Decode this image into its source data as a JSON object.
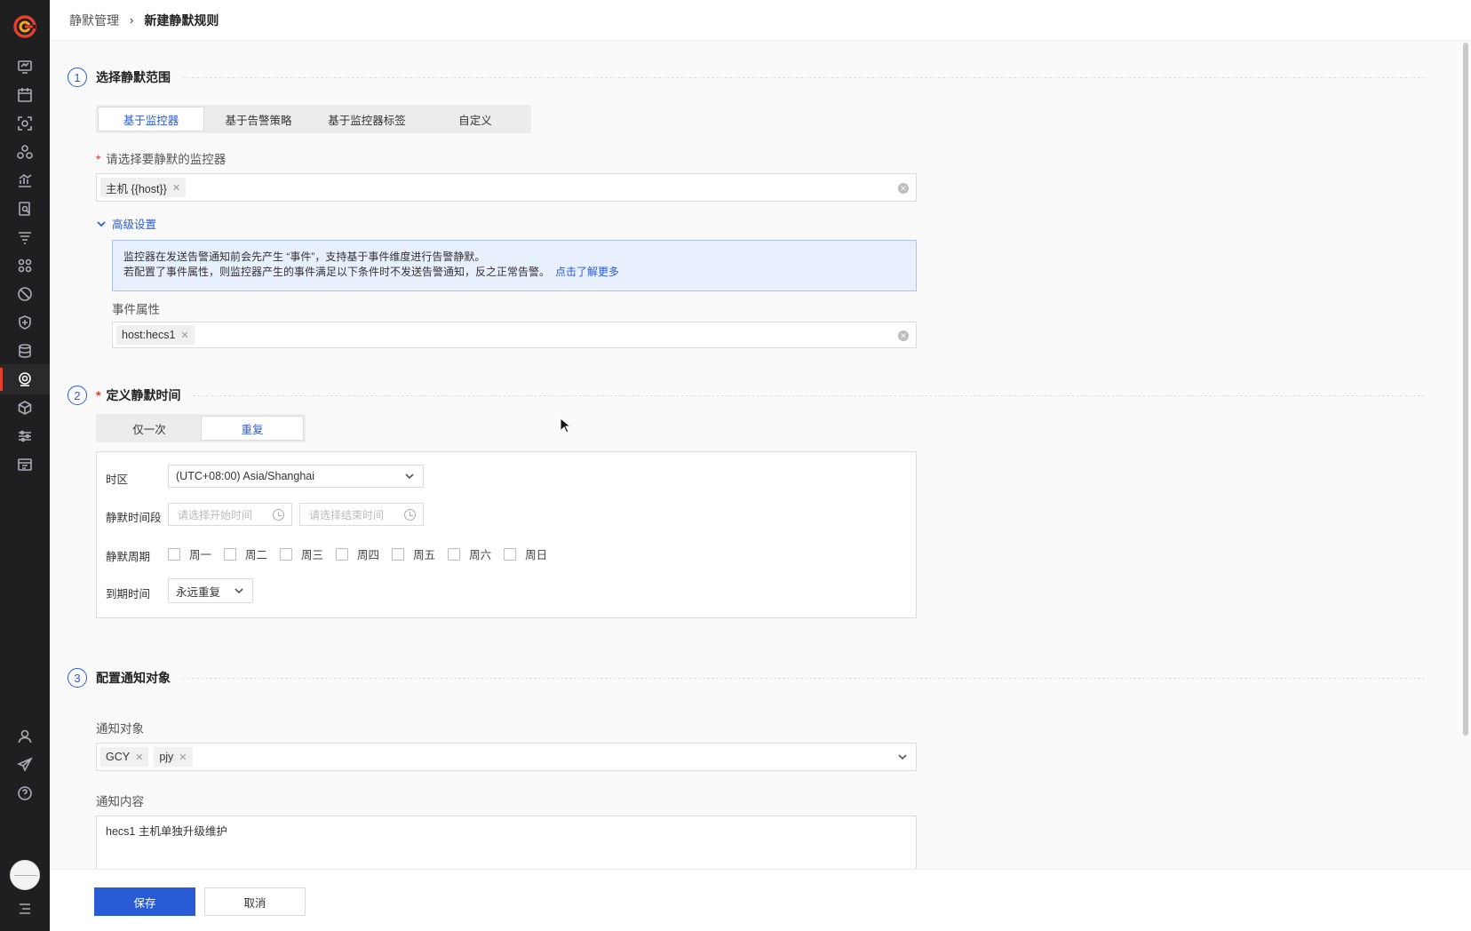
{
  "breadcrumb": {
    "parent": "静默管理",
    "separator": "›",
    "current": "新建静默规则"
  },
  "step1": {
    "number": "1",
    "title": "选择静默范围",
    "tabs": [
      "基于监控器",
      "基于告警策略",
      "基于监控器标签",
      "自定义"
    ],
    "active_tab": "基于监控器",
    "monitor_label": "请选择要静默的监控器",
    "monitor_tags": [
      "主机 {{host}}"
    ],
    "advanced_toggle": "高级设置",
    "info_line1": "监控器在发送告警通知前会先产生 “事件”，支持基于事件维度进行告警静默。",
    "info_line2": "若配置了事件属性，则监控器产生的事件满足以下条件时不发送告警通知，反之正常告警。",
    "info_link": "点击了解更多",
    "event_attr_label": "事件属性",
    "event_tags": [
      "host:hecs1"
    ]
  },
  "step2": {
    "number": "2",
    "title": "定义静默时间",
    "tabs": [
      "仅一次",
      "重复"
    ],
    "active_tab": "重复",
    "timezone_label": "时区",
    "timezone_value": "(UTC+08:00) Asia/Shanghai",
    "period_label": "静默时间段",
    "start_placeholder": "请选择开始时间",
    "end_placeholder": "请选择结束时间",
    "cycle_label": "静默周期",
    "weekdays": [
      "周一",
      "周二",
      "周三",
      "周四",
      "周五",
      "周六",
      "周日"
    ],
    "expire_label": "到期时间",
    "expire_value": "永远重复"
  },
  "step3": {
    "number": "3",
    "title": "配置通知对象",
    "target_label": "通知对象",
    "target_tags": [
      "GCY",
      "pjy"
    ],
    "content_label": "通知内容",
    "content_value": "hecs1 主机单独升级维护"
  },
  "footer": {
    "save": "保存",
    "cancel": "取消"
  },
  "colors": {
    "accent": "#2a5bd7",
    "sidebar": "#1f1f21",
    "required": "#e0382f",
    "logo": "#e6412a"
  }
}
